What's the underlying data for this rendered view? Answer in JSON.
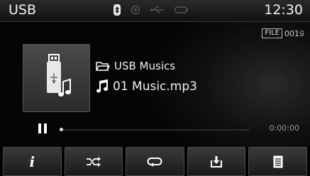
{
  "status_bar": {
    "source_label": "USB",
    "clock": "12:30",
    "icons": [
      "bluetooth-icon",
      "sync-icon",
      "usb-icon",
      "battery-icon"
    ]
  },
  "file_counter": {
    "badge": "FILE",
    "number": "0019"
  },
  "now_playing": {
    "folder": "USB Musics",
    "song": "01 Music.mp3",
    "album_art_icon": "usb-music-icon"
  },
  "playback": {
    "state_icon": "pause-icon",
    "elapsed": "0:00:00",
    "progress_fraction": 0
  },
  "controls": [
    {
      "name": "info-button",
      "icon": "info-icon",
      "glyph": "i"
    },
    {
      "name": "shuffle-button",
      "icon": "shuffle-icon"
    },
    {
      "name": "repeat-button",
      "icon": "repeat-icon"
    },
    {
      "name": "copy-button",
      "icon": "download-icon"
    },
    {
      "name": "list-button",
      "icon": "list-icon"
    }
  ],
  "colors": {
    "background": "#000000",
    "text": "#f0f0f0",
    "button": "#2a2a2a"
  }
}
